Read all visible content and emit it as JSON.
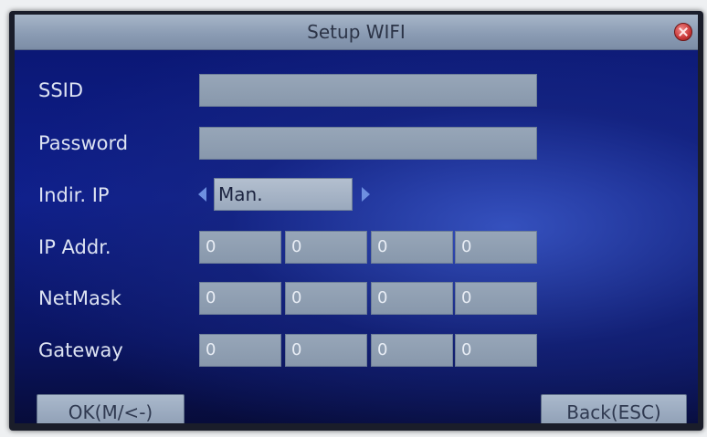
{
  "window": {
    "title": "Setup WIFI"
  },
  "form": {
    "ssid": {
      "label": "SSID",
      "value": ""
    },
    "password": {
      "label": "Password",
      "value": ""
    },
    "indir_ip": {
      "label": "Indir. IP",
      "value": "Man."
    },
    "ip_addr": {
      "label": "IP Addr.",
      "octets": [
        "0",
        "0",
        "0",
        "0"
      ]
    },
    "netmask": {
      "label": "NetMask",
      "octets": [
        "0",
        "0",
        "0",
        "0"
      ]
    },
    "gateway": {
      "label": "Gateway",
      "octets": [
        "0",
        "0",
        "0",
        "0"
      ]
    }
  },
  "buttons": {
    "ok_label": "OK(M/<-)",
    "back_label": "Back(ESC)"
  },
  "icons": {
    "close": "close-icon",
    "prev": "arrow-left-icon",
    "next": "arrow-right-icon"
  },
  "colors": {
    "background": "#0f1f8c",
    "titlebar": "#8b9cb4",
    "field": "#8898ac",
    "close": "#c93636"
  }
}
